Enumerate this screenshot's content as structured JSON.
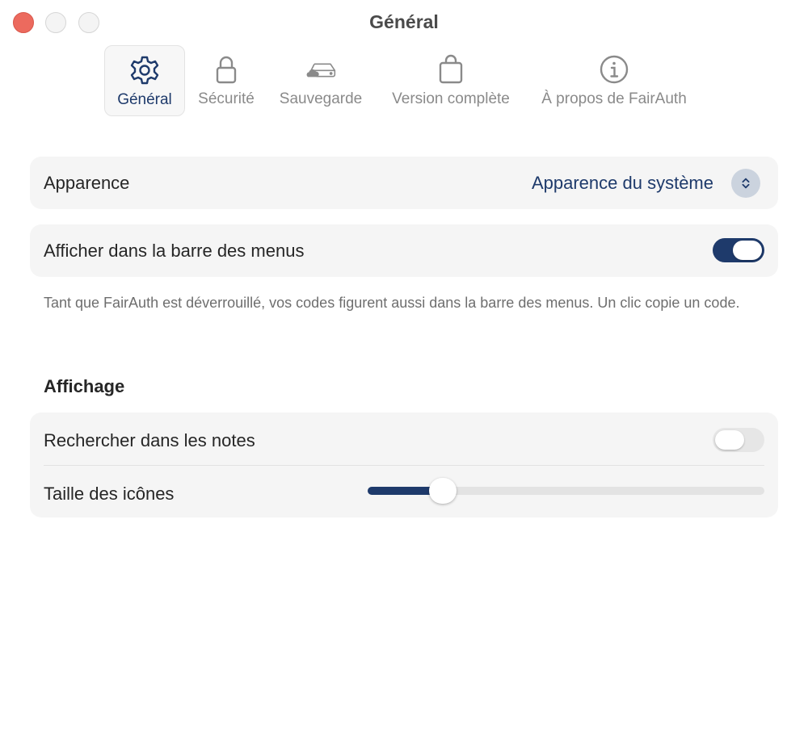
{
  "window": {
    "title": "Général"
  },
  "tabs": [
    {
      "label": "Général",
      "icon": "gear-icon",
      "active": true
    },
    {
      "label": "Sécurité",
      "icon": "lock-icon",
      "active": false
    },
    {
      "label": "Sauvegarde",
      "icon": "cloud-drive-icon",
      "active": false
    },
    {
      "label": "Version complète",
      "icon": "shopping-bag-icon",
      "active": false
    },
    {
      "label": "À propos de FairAuth",
      "icon": "info-icon",
      "active": false
    }
  ],
  "appearance": {
    "label": "Apparence",
    "value": "Apparence du système"
  },
  "menubar": {
    "label": "Afficher dans la barre des menus",
    "enabled": true,
    "footnote": "Tant que FairAuth est déverrouillé, vos codes figurent aussi dans la barre des menus. Un clic copie un code."
  },
  "display": {
    "section_title": "Affichage",
    "search_notes": {
      "label": "Rechercher dans les notes",
      "enabled": false
    },
    "icon_size": {
      "label": "Taille des icônes",
      "fraction": 0.19
    }
  },
  "colors": {
    "accent": "#1e3a6b",
    "close_button": "#ec6a5e"
  }
}
